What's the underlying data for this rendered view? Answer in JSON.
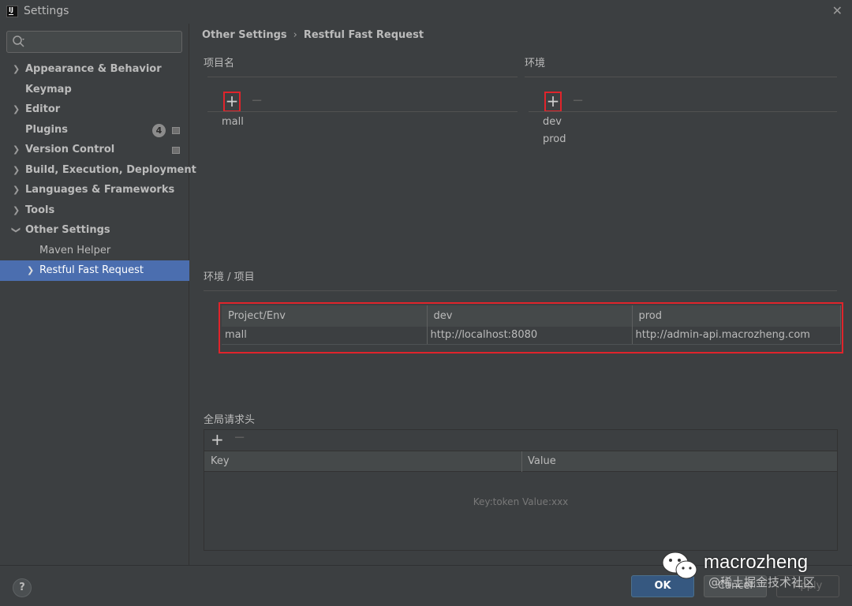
{
  "window": {
    "title": "Settings",
    "app_icon_label": "IJ"
  },
  "search": {
    "placeholder": "",
    "value": ""
  },
  "sidebar": {
    "items": [
      {
        "label": "Appearance & Behavior",
        "expandable": true
      },
      {
        "label": "Keymap",
        "expandable": false
      },
      {
        "label": "Editor",
        "expandable": true
      },
      {
        "label": "Plugins",
        "expandable": false,
        "badge": "4"
      },
      {
        "label": "Version Control",
        "expandable": true
      },
      {
        "label": "Build, Execution, Deployment",
        "expandable": true
      },
      {
        "label": "Languages & Frameworks",
        "expandable": true
      },
      {
        "label": "Tools",
        "expandable": true
      },
      {
        "label": "Other Settings",
        "expandable": true,
        "expanded": true
      },
      {
        "label": "Maven Helper",
        "child": true
      },
      {
        "label": "Restful Fast Request",
        "child": true,
        "selected": true
      }
    ]
  },
  "breadcrumb": {
    "parent": "Other Settings",
    "separator": "›",
    "current": "Restful Fast Request"
  },
  "projects": {
    "label": "项目名",
    "items": [
      "mall"
    ]
  },
  "envs": {
    "label": "环境",
    "items": [
      "dev",
      "prod"
    ]
  },
  "env_project": {
    "label": "环境 / 项目",
    "columns": [
      "Project/Env",
      "dev",
      "prod"
    ],
    "rows": [
      [
        "mall",
        "http://localhost:8080",
        "http://admin-api.macrozheng.com"
      ]
    ]
  },
  "global_headers": {
    "label": "全局请求头",
    "columns": [
      "Key",
      "Value"
    ],
    "empty_text": "Key:token  Value:xxx"
  },
  "toolbar": {
    "add_symbol": "+",
    "remove_symbol": "−"
  },
  "footer": {
    "help_label": "?",
    "ok_label": "OK",
    "cancel_label": "Cancel",
    "apply_label": "Apply"
  },
  "watermark": {
    "name": "macrozheng",
    "sub": "@稀土掘金技术社区"
  },
  "colors": {
    "background": "#3c3f41",
    "selection": "#4b6eaf",
    "highlight_border": "#e0242b",
    "ok_button": "#365880"
  },
  "icons": [
    "search-icon",
    "close-icon",
    "chevron-right-icon",
    "chevron-down-icon",
    "add-icon",
    "remove-icon",
    "help-icon",
    "wechat-icon"
  ]
}
